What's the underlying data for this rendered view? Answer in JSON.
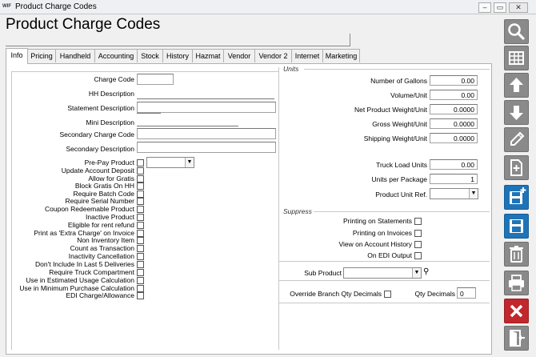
{
  "window": {
    "title": "Product Charge Codes",
    "icon_text": "WIF"
  },
  "page": {
    "title": "Product Charge Codes"
  },
  "tabs": [
    "Info",
    "Pricing",
    "Handheld",
    "Accounting",
    "Stock",
    "History",
    "Hazmat",
    "Vendor",
    "Vendor 2",
    "Internet",
    "Marketing"
  ],
  "active_tab": "Info",
  "left": {
    "charge_code": "Charge Code",
    "hh_description": "HH Description",
    "statement_description": "Statement Description",
    "mini_description": "Mini Description",
    "secondary_charge_code": "Secondary Charge Code",
    "secondary_description": "Secondary Description",
    "checkboxes": [
      "Pre-Pay Product",
      "Update Account Deposit",
      "Allow for Gratis",
      "Block Gratis On HH",
      "Require Batch Code",
      "Require Serial Number",
      "Coupon Redeemable Product",
      "Inactive Product",
      "Eligible for rent refund",
      "Print as 'Extra Charge' on Invoice",
      "Non Inventory Item",
      "Count as Transaction",
      "Inactivity Cancellation",
      "Don't Include In Last 5 Deliveries",
      "Require Truck Compartment",
      "Use in Estimated Usage Calculation",
      "Use in Minimum Purchase Calculation",
      "EDI Charge/Allowance"
    ]
  },
  "units": {
    "group_label": "Units",
    "number_of_gallons": {
      "label": "Number of Gallons",
      "value": "0.00"
    },
    "volume_unit": {
      "label": "Volume/Unit",
      "value": "0.00"
    },
    "net_weight": {
      "label": "Net Product Weight/Unit",
      "value": "0.0000"
    },
    "gross_weight": {
      "label": "Gross Weight/Unit",
      "value": "0.0000"
    },
    "shipping_weight": {
      "label": "Shipping Weight/Unit",
      "value": "0.0000"
    },
    "truck_load_units": {
      "label": "Truck Load Units",
      "value": "0.00"
    },
    "units_per_package": {
      "label": "Units per Package",
      "value": "1"
    },
    "product_unit_ref": {
      "label": "Product Unit Ref."
    }
  },
  "suppress": {
    "group_label": "Suppress",
    "items": [
      "Printing on Statements",
      "Printing on Invoices",
      "View on Account History",
      "On EDI Output"
    ]
  },
  "bottom": {
    "sub_product": "Sub Product",
    "override_branch": "Override Branch Qty Decimals",
    "qty_decimals_label": "Qty Decimals",
    "qty_decimals_value": "0"
  },
  "toolbar": [
    "search-icon",
    "grid-icon",
    "arrow-up-icon",
    "arrow-down-icon",
    "pencil-icon",
    "new-document-icon",
    "save-new-icon",
    "save-icon",
    "trash-icon",
    "print-icon",
    "close-x-icon",
    "exit-door-icon"
  ]
}
